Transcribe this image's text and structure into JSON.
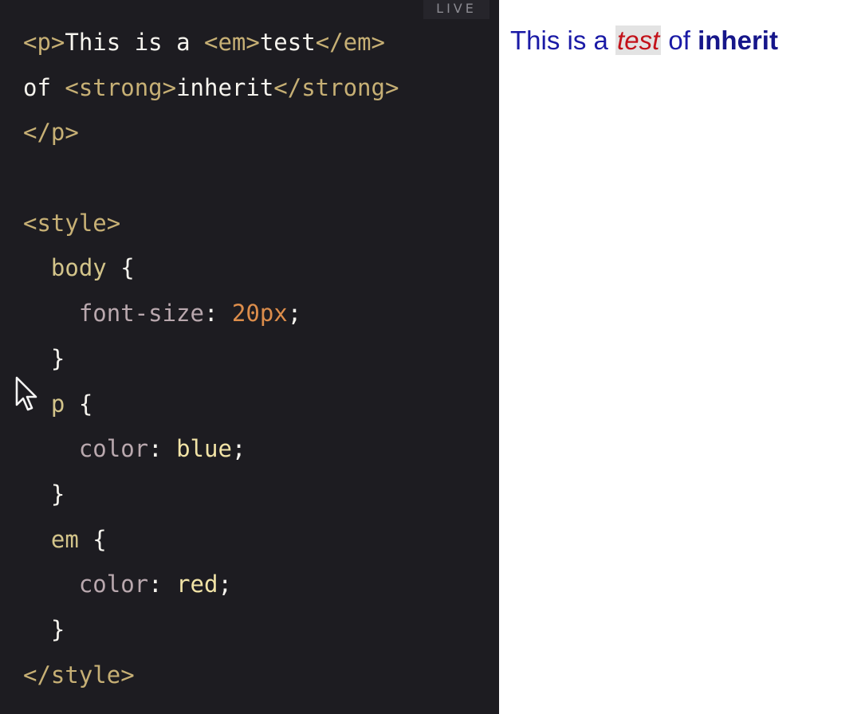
{
  "editor": {
    "live_label": "LIVE",
    "lines": [
      [
        {
          "t": "<p>",
          "c": "tag"
        },
        {
          "t": "This is a ",
          "c": "text"
        },
        {
          "t": "<em>",
          "c": "tag"
        },
        {
          "t": "test",
          "c": "text"
        },
        {
          "t": "</em>",
          "c": "tag"
        }
      ],
      [
        {
          "t": "of ",
          "c": "text"
        },
        {
          "t": "<strong>",
          "c": "tag"
        },
        {
          "t": "inherit",
          "c": "text"
        },
        {
          "t": "</strong>",
          "c": "tag"
        }
      ],
      [
        {
          "t": "</p>",
          "c": "tag"
        }
      ],
      [],
      [
        {
          "t": "<style>",
          "c": "tag"
        }
      ],
      [
        {
          "t": "  ",
          "c": "text"
        },
        {
          "t": "body",
          "c": "sel"
        },
        {
          "t": " {",
          "c": "brace"
        }
      ],
      [
        {
          "t": "    ",
          "c": "text"
        },
        {
          "t": "font-size",
          "c": "prop"
        },
        {
          "t": ": ",
          "c": "punct"
        },
        {
          "t": "20px",
          "c": "num"
        },
        {
          "t": ";",
          "c": "punct"
        }
      ],
      [
        {
          "t": "  ",
          "c": "text"
        },
        {
          "t": "}",
          "c": "brace"
        }
      ],
      [
        {
          "t": "  ",
          "c": "text"
        },
        {
          "t": "p",
          "c": "sel"
        },
        {
          "t": " {",
          "c": "brace"
        }
      ],
      [
        {
          "t": "    ",
          "c": "text"
        },
        {
          "t": "color",
          "c": "prop"
        },
        {
          "t": ": ",
          "c": "punct"
        },
        {
          "t": "blue",
          "c": "kw"
        },
        {
          "t": ";",
          "c": "punct"
        }
      ],
      [
        {
          "t": "  ",
          "c": "text"
        },
        {
          "t": "}",
          "c": "brace"
        }
      ],
      [
        {
          "t": "  ",
          "c": "text"
        },
        {
          "t": "em",
          "c": "sel"
        },
        {
          "t": " {",
          "c": "brace"
        }
      ],
      [
        {
          "t": "    ",
          "c": "text"
        },
        {
          "t": "color",
          "c": "prop"
        },
        {
          "t": ": ",
          "c": "punct"
        },
        {
          "t": "red",
          "c": "kw"
        },
        {
          "t": ";",
          "c": "punct"
        }
      ],
      [
        {
          "t": "  ",
          "c": "text"
        },
        {
          "t": "}",
          "c": "brace"
        }
      ],
      [
        {
          "t": "</style>",
          "c": "tag"
        }
      ]
    ]
  },
  "preview": {
    "part1": "This is a ",
    "em_text": "test",
    "part2": " of ",
    "strong_text": "inherit"
  },
  "colors": {
    "editor_bg": "#1d1c21",
    "tag": "#c7b075",
    "number": "#dc8d4b",
    "preview_text": "#1a1aa6",
    "preview_em": "#c3121a"
  },
  "icons": {
    "cursor": "mouse-pointer-icon"
  }
}
